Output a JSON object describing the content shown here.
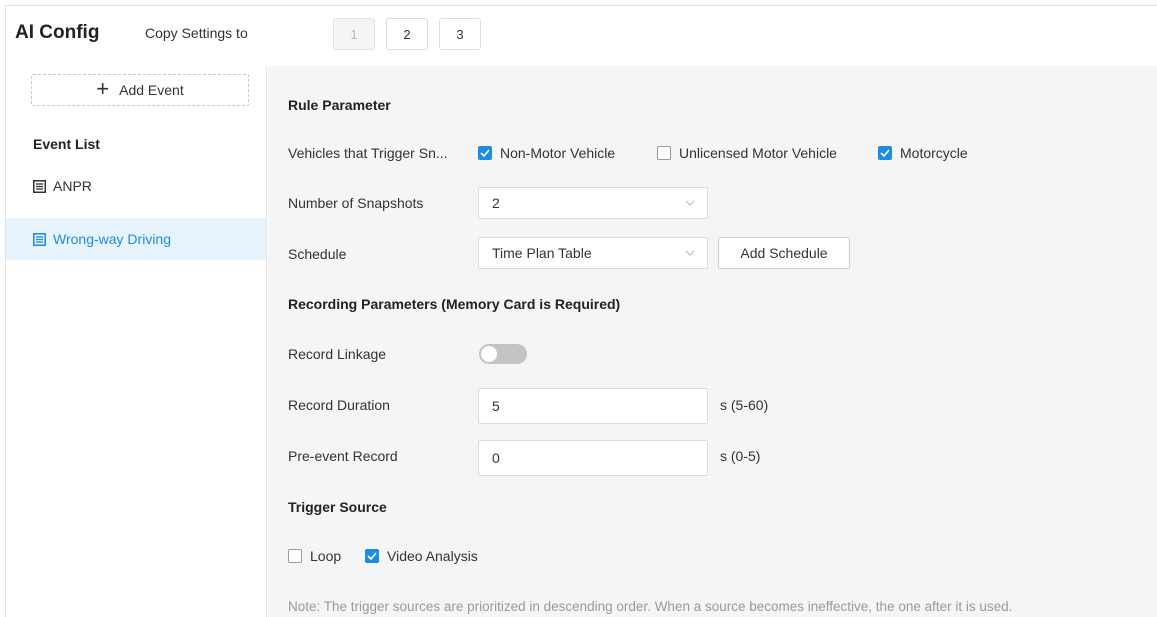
{
  "header": {
    "title": "AI Config",
    "copy_label": "Copy Settings to",
    "channels": [
      "1",
      "2",
      "3"
    ]
  },
  "sidebar": {
    "add_event_label": "Add Event",
    "event_list_title": "Event List",
    "events": [
      {
        "label": "ANPR",
        "active": false
      },
      {
        "label": "Wrong-way Driving",
        "active": true
      }
    ]
  },
  "rule": {
    "title": "Rule Parameter",
    "vehicles_label": "Vehicles that Trigger Sn...",
    "vehicle_options": [
      {
        "label": "Non-Motor Vehicle",
        "checked": true
      },
      {
        "label": "Unlicensed Motor Vehicle",
        "checked": false
      },
      {
        "label": "Motorcycle",
        "checked": true
      }
    ],
    "snapshots_label": "Number of Snapshots",
    "snapshots_value": "2",
    "schedule_label": "Schedule",
    "schedule_value": "Time Plan Table",
    "add_schedule_label": "Add Schedule"
  },
  "recording": {
    "title": "Recording Parameters (Memory Card is Required)",
    "linkage_label": "Record Linkage",
    "linkage_on": false,
    "duration_label": "Record Duration",
    "duration_value": "5",
    "duration_unit": "s (5-60)",
    "pre_event_label": "Pre-event Record",
    "pre_event_value": "0",
    "pre_event_unit": "s (0-5)"
  },
  "trigger": {
    "title": "Trigger Source",
    "options": [
      {
        "label": "Loop",
        "checked": false
      },
      {
        "label": "Video Analysis",
        "checked": true
      }
    ],
    "note": "Note: The trigger sources are prioritized in descending order. When a source becomes ineffective, the one after it is used."
  },
  "colors": {
    "accent": "#1a8ce6",
    "active_bg": "#e8f4fd",
    "toggle_off": "#c4c4c4"
  }
}
